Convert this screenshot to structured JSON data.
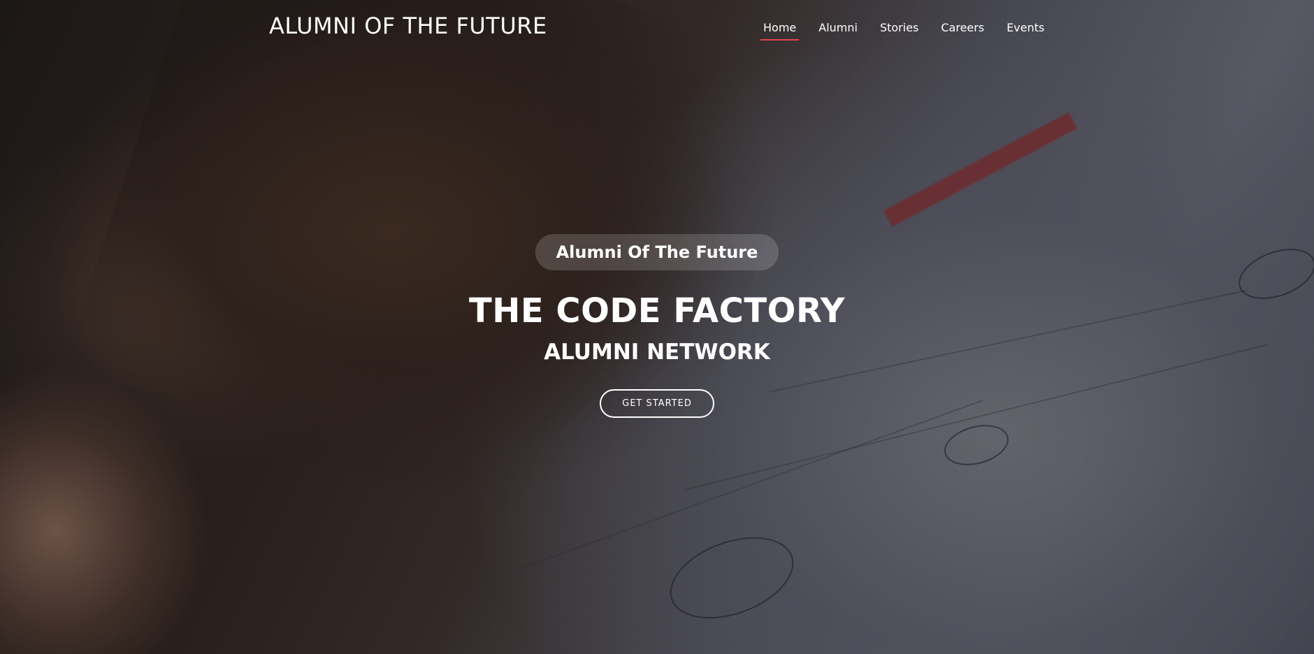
{
  "header": {
    "logo_text": "ALUMNI OF THE FUTURE",
    "nav": [
      {
        "label": "Home",
        "active": true
      },
      {
        "label": "Alumni",
        "active": false
      },
      {
        "label": "Stories",
        "active": false
      },
      {
        "label": "Careers",
        "active": false
      },
      {
        "label": "Events",
        "active": false
      }
    ]
  },
  "hero": {
    "badge_text": "Alumni Of The Future",
    "title": "THE CODE FACTORY",
    "subtitle": "ALUMNI NETWORK",
    "cta_label": "GET STARTED",
    "background_image": "photo-student-head-on-math-papers"
  },
  "colors": {
    "nav_active_underline": "#e8434d",
    "text": "#ffffff"
  }
}
